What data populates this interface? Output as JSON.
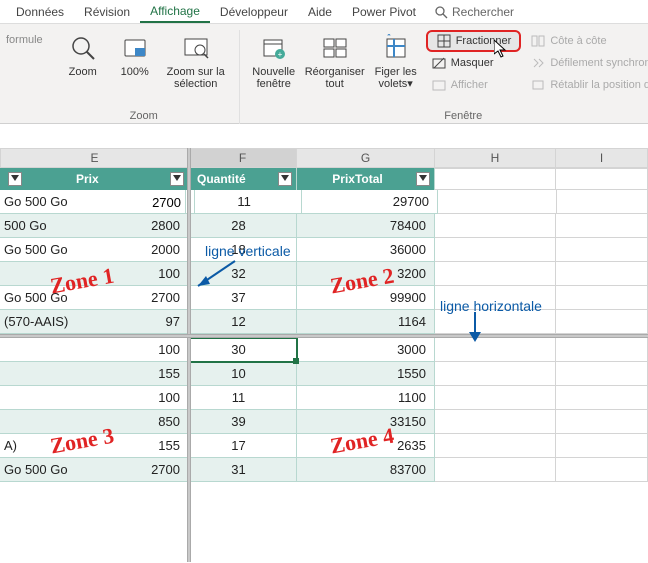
{
  "tabs": {
    "donnees": "Données",
    "revision": "Révision",
    "affichage": "Affichage",
    "developpeur": "Développeur",
    "aide": "Aide",
    "powerpivot": "Power Pivot",
    "rechercher": "Rechercher"
  },
  "formula_prefix": "formule",
  "ribbon": {
    "zoom_group": "Zoom",
    "zoom": "Zoom",
    "pct100": "100%",
    "zoom_sel": "Zoom sur la sélection",
    "new_win": "Nouvelle fenêtre",
    "arrange": "Réorganiser tout",
    "freeze": "Figer les volets",
    "split": "Fractionner",
    "hide": "Masquer",
    "unhide": "Afficher",
    "sidebyside": "Côte à côte",
    "syncscroll": "Défilement synchrone",
    "resetpos": "Rétablir la position de la f",
    "window_group": "Fenêtre"
  },
  "columns": {
    "E": "E",
    "F": "F",
    "G": "G",
    "H": "H",
    "I": "I"
  },
  "headers": {
    "prix": "Prix",
    "quantite": "Quantité",
    "prixtotal": "PrixTotal"
  },
  "rows_top": [
    {
      "e": "Go 500 Go",
      "prix": "2700",
      "qte": "11",
      "tot": "29700"
    },
    {
      "e": "500 Go",
      "prix": "2800",
      "qte": "28",
      "tot": "78400"
    },
    {
      "e": "Go 500 Go",
      "prix": "2000",
      "qte": "18",
      "tot": "36000"
    },
    {
      "e": "",
      "prix": "100",
      "qte": "32",
      "tot": "3200"
    },
    {
      "e": "Go 500 Go",
      "prix": "2700",
      "qte": "37",
      "tot": "99900"
    },
    {
      "e": "(570-AAIS)",
      "prix": "97",
      "qte": "12",
      "tot": "1164"
    }
  ],
  "rows_bottom": [
    {
      "e": "",
      "prix": "100",
      "qte": "30",
      "tot": "3000"
    },
    {
      "e": "",
      "prix": "155",
      "qte": "10",
      "tot": "1550"
    },
    {
      "e": "",
      "prix": "100",
      "qte": "11",
      "tot": "1100"
    },
    {
      "e": "",
      "prix": "850",
      "qte": "39",
      "tot": "33150"
    },
    {
      "e": "A)",
      "prix": "155",
      "qte": "17",
      "tot": "2635"
    },
    {
      "e": "Go 500 Go",
      "prix": "2700",
      "qte": "31",
      "tot": "83700"
    }
  ],
  "annotations": {
    "zone1": "Zone 1",
    "zone2": "Zone 2",
    "zone3": "Zone 3",
    "zone4": "Zone 4",
    "lv": "ligne verticale",
    "lh": "ligne horizontale"
  }
}
